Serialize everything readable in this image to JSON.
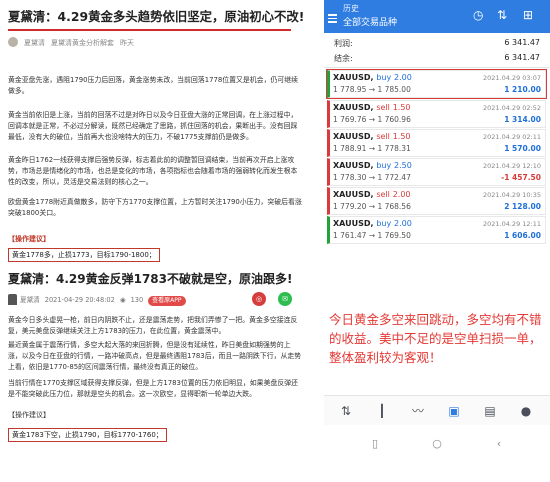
{
  "article1": {
    "title": "夏黛清：4.29黄金多头趋势依旧坚定，原油初心不改!",
    "author": "夏黛清",
    "column": "夏黛清黄金分析解套",
    "date": "昨天",
    "paragraphs": [
      "黄金亚盘先涨，遇阻1790压力后回落，黄金涨势未改，当前回落1778位置又是机会，仍可继续做多。",
      "黄金当前依旧是上涨，当前的回落不过是对昨日以及今日亚盘大涨的正常回调，在上涨过程中，回调本就是正常，不必过分解读，既然已经确定了思路，抓住回落的机会，果断出手。没有回踩最低，没有大的破位，当前再大也没啥特大的压力，不破1775支撑前仍是做多。",
      "黄金昨日1762一线获得支撑后强势反弹，标志着此前的调整暂回调结束，当前再次开启上涨攻势，市场总是情绪化的市场，也总是变化的市场，各项指标也会随着市场的强弱转化而发生根本性的改变，所以，灵活是交易法则的核心之一。",
      "欧盘黄金1778附近真做散多，防守下方1770支撑位置，上方暂时关注1790小压力，突破后看涨突破1800关口。"
    ],
    "tag": "【操作建议】",
    "suggestion": "黄金1778多，止损1773，目标1790-1800；"
  },
  "article2": {
    "title": "夏黛清：4.29黄金反弹1783不破就是空，原油跟多!",
    "author": "夏黛清",
    "datetime": "2021-04-29 20:48:02",
    "views": "130",
    "app_button": "查看原APP",
    "paragraphs": [
      "黄金今日多头虚晃一枪，前日内阴跌不止，还是震荡走势，把我们弄惨了一把。黄金多空接连反复，美元美盘反弹继续关注上方1783的压力，在此位置，黄金震荡中。",
      "最近黄金属于震荡行情，多空大起大落的来回折腾，但是没有延续性，昨日美盘如期强势的上涨，以及今日在亚盘的行情，一路冲破高点，但是最终遇阻1783后，而且一路阴跌下行，从走势上看，依旧是1770-85的区间震荡行情，最终没有真正的破位。",
      "当前行情在1770支撑区域获得支撑反弹，但是上方1783位置的压力依旧明显，如果美盘反弹还是不能突破此压力位，那就是空头的机会。这一次欧空，显得职新一轮单边大跌。"
    ],
    "tag": "【操作建议】",
    "suggestion": "黄金1783下空，止损1790，目标1770-1760；"
  },
  "phone": {
    "header_small": "历史",
    "header_title": "全部交易品种",
    "summary": [
      {
        "label": "利润:",
        "value": "6 341.47"
      },
      {
        "label": "结余:",
        "value": "6 341.47"
      }
    ],
    "trades": [
      {
        "symbol": "XAUUSD,",
        "side": "buy",
        "lots": "2.00",
        "prices": "1 778.95 → 1 785.00",
        "date": "2021.04.29 03:07",
        "pl": "1 210.00"
      },
      {
        "symbol": "XAUUSD,",
        "side": "sell",
        "lots": "1.50",
        "prices": "1 769.76 → 1 760.96",
        "date": "2021.04.29 02:52",
        "pl": "1 314.00"
      },
      {
        "symbol": "XAUUSD,",
        "side": "sell",
        "lots": "1.50",
        "prices": "1 788.91 → 1 778.31",
        "date": "2021.04.29 02:11",
        "pl": "1 570.00"
      },
      {
        "symbol": "XAUUSD,",
        "side": "buy",
        "lots": "2.50",
        "prices": "1 778.30 → 1 772.47",
        "date": "2021.04.29 12:10",
        "pl": "-1 457.50"
      },
      {
        "symbol": "XAUUSD,",
        "side": "sell",
        "lots": "2.00",
        "prices": "1 779.20 → 1 768.56",
        "date": "2021.04.29 10:35",
        "pl": "2 128.00"
      },
      {
        "symbol": "XAUUSD,",
        "side": "buy",
        "lots": "2.00",
        "prices": "1 761.47 → 1 769.50",
        "date": "2021.04.29 12:11",
        "pl": "1 606.00"
      }
    ],
    "note": "今日黄金多空来回跳动，多空均有不错的收益。美中不足的是空单扫损一单，整体盈利较为客观！"
  },
  "icons": [
    "menu-icon",
    "clock-icon",
    "sort-icon",
    "add-order-icon",
    "quotes-icon",
    "chart-icon",
    "trend-icon",
    "history-icon",
    "news-icon",
    "chat-icon",
    "back-icon",
    "home-icon",
    "recent-icon",
    "eye-icon",
    "share-icon"
  ],
  "colors": {
    "accent_blue": "#2f7de1",
    "highlight_red": "#d32b2b",
    "buy_green": "#20a33b",
    "sell_red": "#d93b3b"
  }
}
